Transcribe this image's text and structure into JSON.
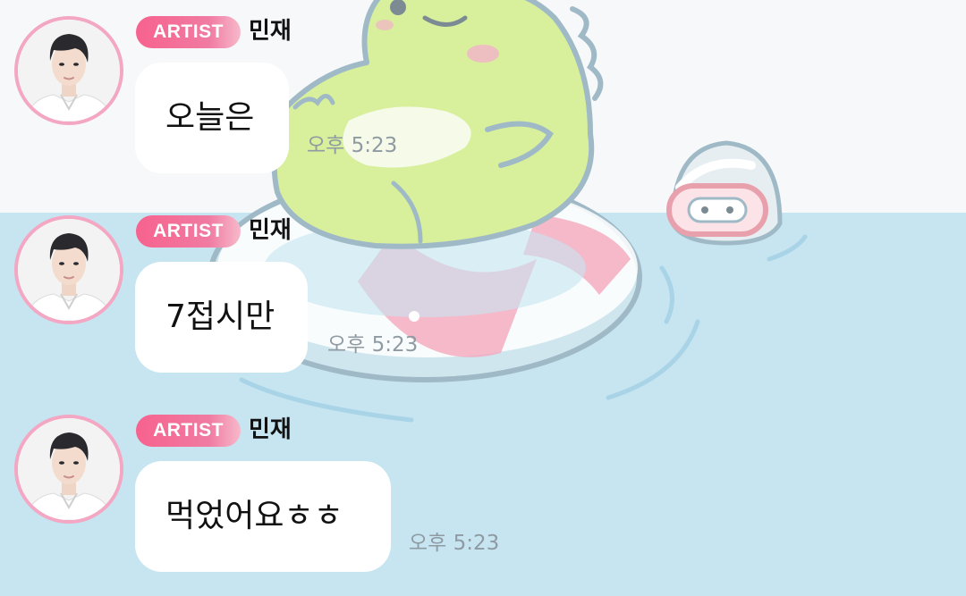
{
  "colors": {
    "badge": "#f7628e",
    "avatar_ring": "#f3a7c3",
    "bubble": "#ffffff",
    "time": "#8f9aa3",
    "water": "#c6e5f1"
  },
  "background": {
    "illustration_icon": "green-dinosaur-on-float-icon",
    "secondary_icon": "penguin-with-goggles-icon"
  },
  "messages": [
    {
      "badge": "ARTIST",
      "sender": "민재",
      "text": "오늘은",
      "time": "오후 5:23",
      "avatar_icon": "artist-avatar-icon"
    },
    {
      "badge": "ARTIST",
      "sender": "민재",
      "text": "7접시만",
      "time": "오후 5:23",
      "avatar_icon": "artist-avatar-icon"
    },
    {
      "badge": "ARTIST",
      "sender": "민재",
      "text": "먹었어요ㅎㅎ",
      "time": "오후 5:23",
      "avatar_icon": "artist-avatar-icon"
    }
  ]
}
